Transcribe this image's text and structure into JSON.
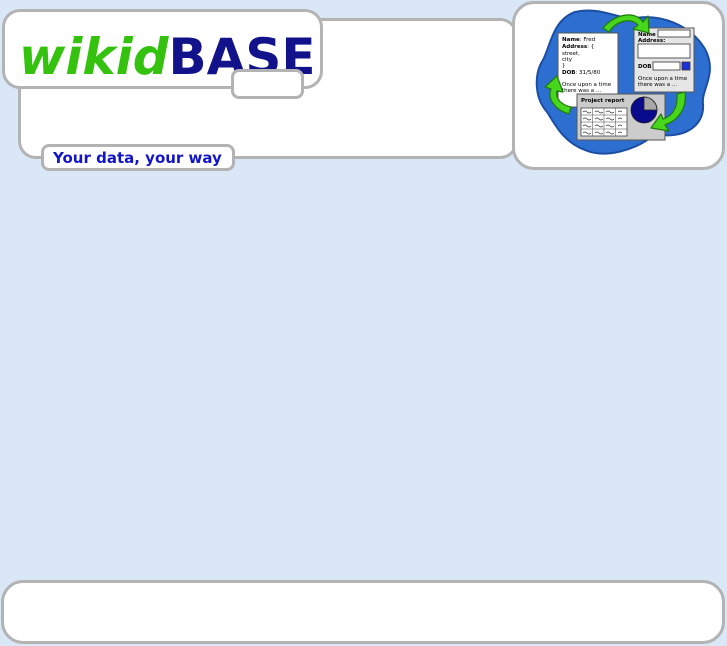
{
  "brand": {
    "name_part1": "wikid",
    "name_part2": "BASE",
    "tagline": "Your data, your way"
  },
  "illustration": {
    "card_left": {
      "name_label": "Name",
      "name_value": ": Fred",
      "address_label": "Address",
      "address_value": ": {",
      "line_street": "street,",
      "line_city": "city",
      "line_close": "}",
      "dob_label": "DOB",
      "dob_value": ": 31/5/80",
      "story_line1": "Once upon a time",
      "story_line2": "there was a ..."
    },
    "card_right": {
      "name_label": "Name",
      "address_label": "Address:",
      "dob_label": "DOB",
      "story_line1": "Once upon a time",
      "story_line2": "there was a ..."
    },
    "report": {
      "title": "Project report"
    }
  },
  "colors": {
    "brand_green": "#35c20e",
    "brand_navy": "#12128a",
    "tagline_blue": "#1515c8",
    "page_bg": "#dae7f6",
    "border_gray": "#b3b3b3"
  }
}
